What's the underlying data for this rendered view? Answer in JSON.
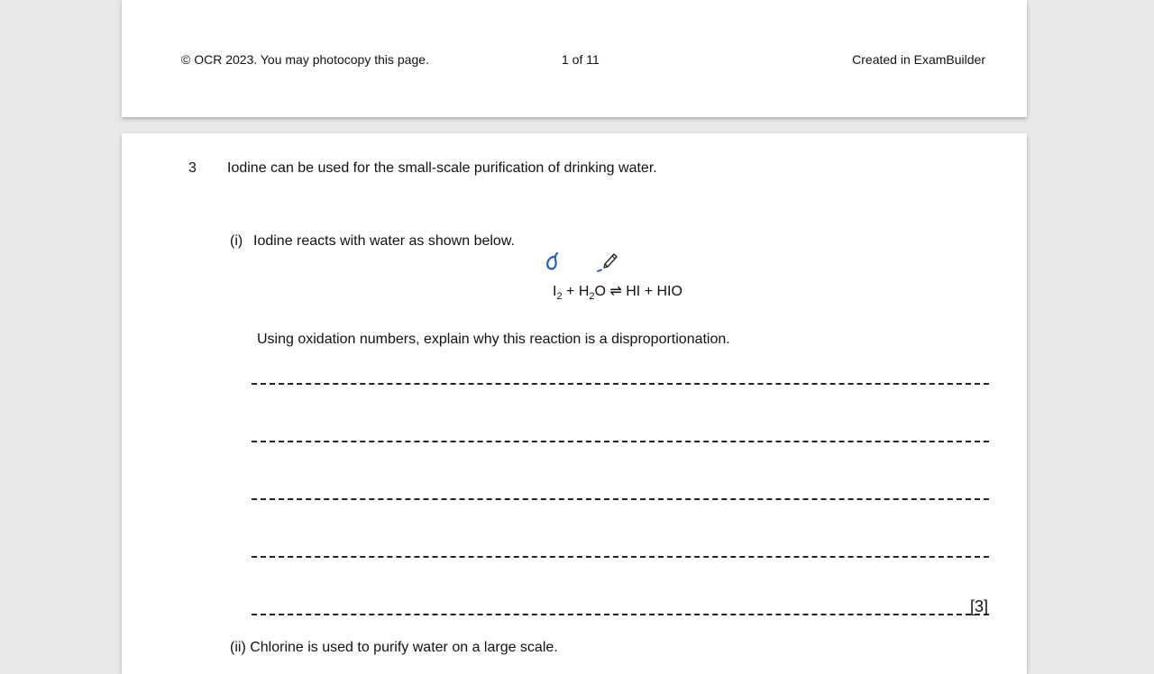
{
  "footer": {
    "copyright": "© OCR 2023. You may photocopy this page.",
    "page_indicator": "1 of 11",
    "created_in": "Created in ExamBuilder"
  },
  "question": {
    "number": "3",
    "stem": "Iodine can be used for the small-scale purification of drinking water.",
    "part_i": {
      "label": "(i)",
      "intro": "Iodine reacts with water as shown below.",
      "equation": {
        "lhs1": "I",
        "lhs1_sub": "2",
        "plus1": " + ",
        "lhs2a": "H",
        "lhs2_sub": "2",
        "lhs2b": "O",
        "arrow": " ⇌ ",
        "rhs": "HI + HIO"
      },
      "instruction": "Using oxidation numbers, explain why this reaction is a disproportionation.",
      "marks": "[3]"
    },
    "part_ii": {
      "label": "(ii)",
      "text_partial": "Chlorine is used to purify water on a large scale."
    }
  },
  "annotation": {
    "handwritten_mark": "0",
    "ink_color": "#1f5fc4",
    "tool_icon": "pen-icon"
  }
}
